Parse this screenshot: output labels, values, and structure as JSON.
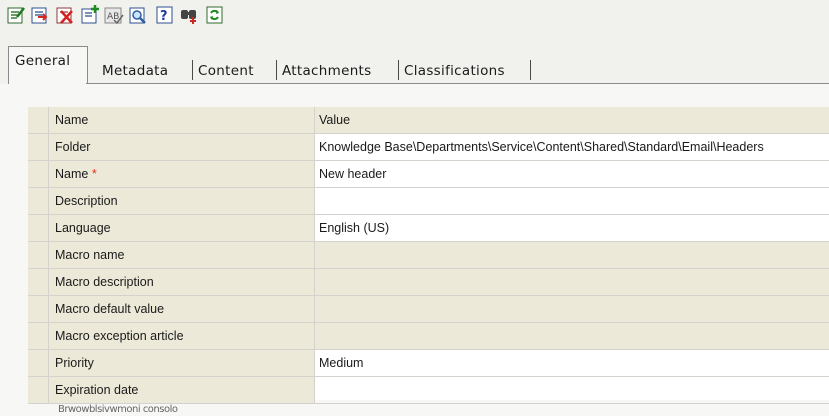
{
  "toolbar": {
    "icons": [
      "save-icon",
      "save-close-icon",
      "delete-icon",
      "new-icon",
      "spell-check-icon",
      "preview-icon",
      "help-icon",
      "find-icon",
      "refresh-icon"
    ]
  },
  "tabs": [
    {
      "label": "General",
      "active": true
    },
    {
      "label": "Metadata",
      "active": false
    },
    {
      "label": "Content",
      "active": false
    },
    {
      "label": "Attachments",
      "active": false
    },
    {
      "label": "Classifications",
      "active": false
    }
  ],
  "grid": {
    "header": {
      "name": "Name",
      "value": "Value"
    },
    "rows": [
      {
        "name": "Folder",
        "value": "Knowledge Base\\Departments\\Service\\Content\\Shared\\Standard\\Email\\Headers",
        "editable": false
      },
      {
        "name": "Name",
        "required_mark": "*",
        "value": "New header",
        "editable": true
      },
      {
        "name": "Description",
        "value": "",
        "editable": true
      },
      {
        "name": "Language",
        "value": "English (US)",
        "editable": true
      },
      {
        "name": "Macro name",
        "value": "",
        "editable": false
      },
      {
        "name": "Macro description",
        "value": "",
        "editable": false
      },
      {
        "name": "Macro default value",
        "value": "",
        "editable": false
      },
      {
        "name": "Macro exception article",
        "value": "",
        "editable": false
      },
      {
        "name": "Priority",
        "value": "Medium",
        "editable": true
      },
      {
        "name": "Expiration date",
        "value": "",
        "editable": true
      }
    ]
  },
  "footer": {
    "partial_text": "Brwowblsivwmoni consolo"
  },
  "colors": {
    "window_bg": "#f1f1ee",
    "label_cell_bg": "#ece9d8",
    "required_star": "#e03020"
  }
}
